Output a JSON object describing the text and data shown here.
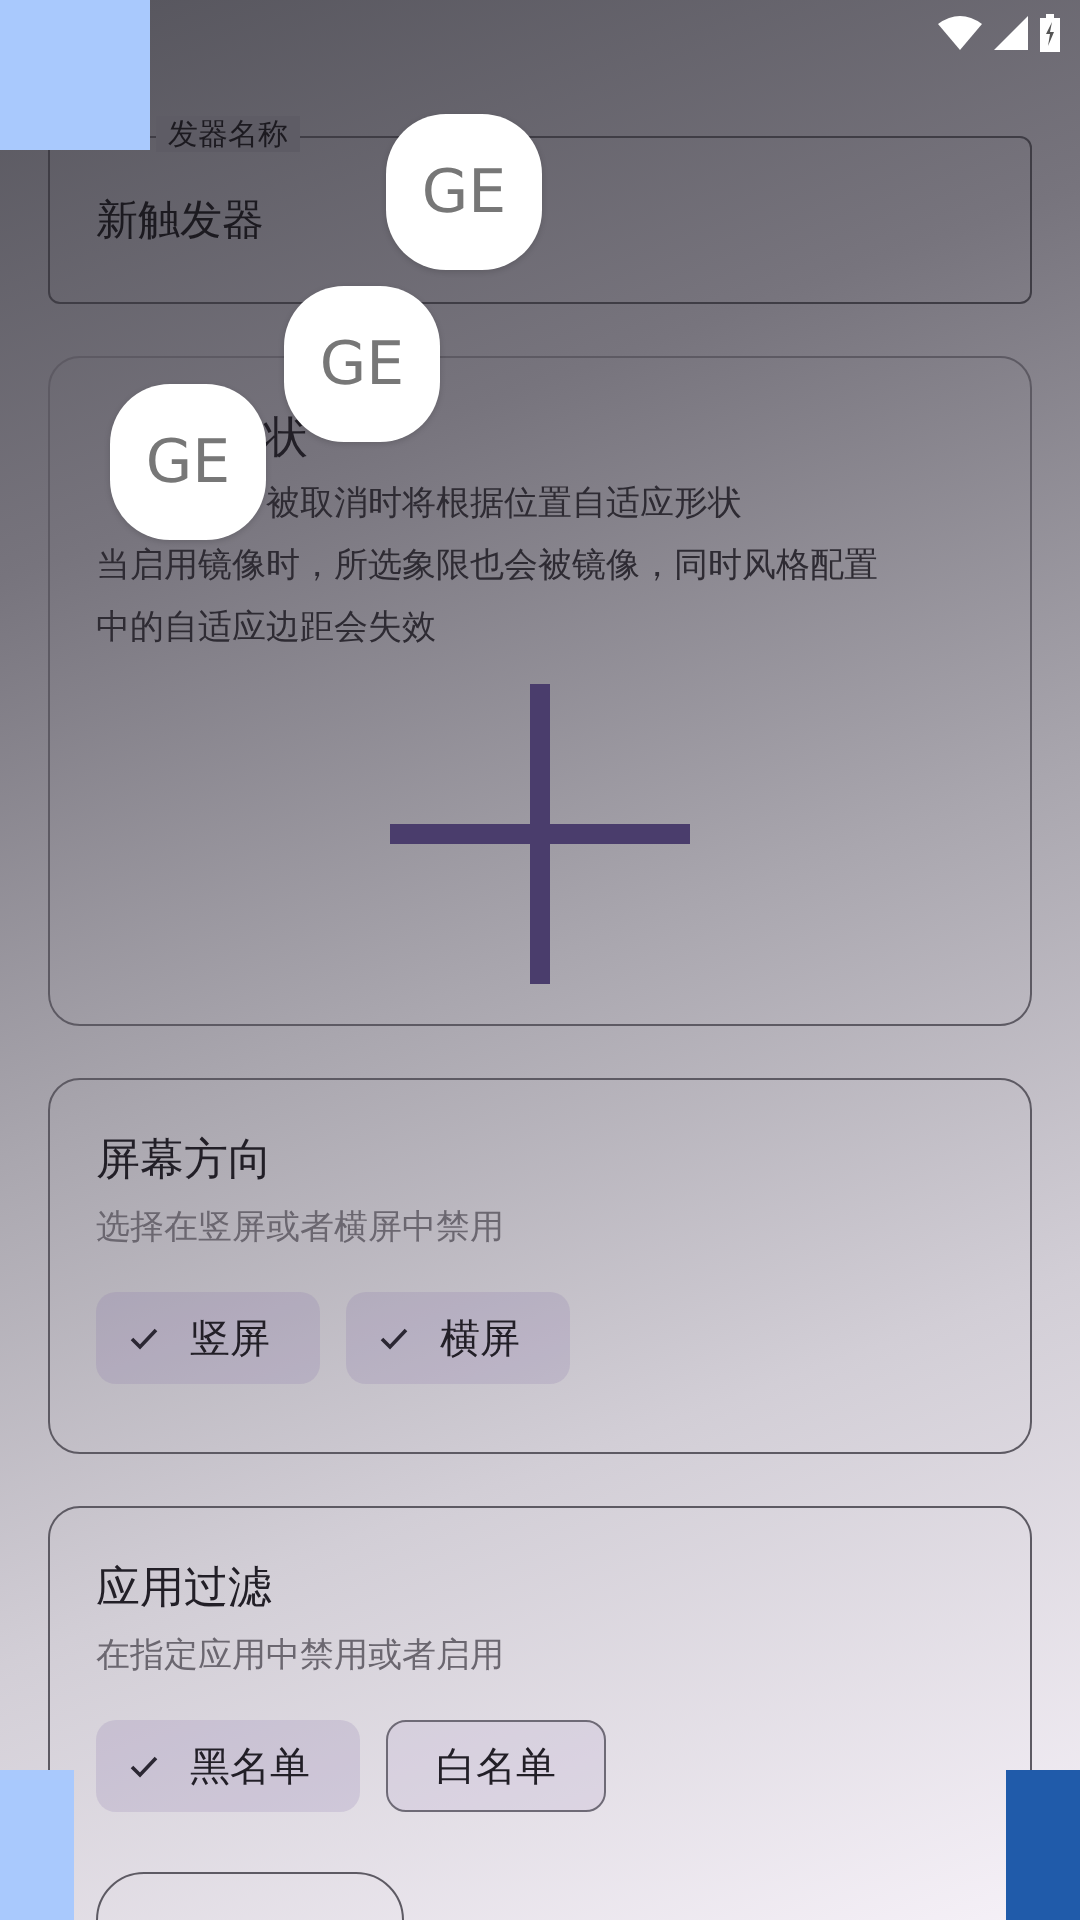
{
  "name_field": {
    "label": "发器名称",
    "value": "新触发器"
  },
  "shape_card": {
    "title": "状",
    "description": "被取消时将根据位置自适应形状",
    "description_lines": [
      "当启用镜像时，所选象限也会被镜像，同时风格配置",
      "中的自适应边距会失效"
    ]
  },
  "orientation_card": {
    "title": "屏幕方向",
    "description": "选择在竖屏或者横屏中禁用",
    "chips": [
      {
        "label": "竖屏",
        "selected": true
      },
      {
        "label": "横屏",
        "selected": true
      }
    ]
  },
  "filter_card": {
    "title": "应用过滤",
    "description": "在指定应用中禁用或者启用",
    "chips": [
      {
        "label": "黑名单",
        "selected": true
      },
      {
        "label": "白名单",
        "selected": false
      }
    ]
  },
  "floating_buttons": [
    {
      "label": "GE"
    },
    {
      "label": "GE"
    },
    {
      "label": "GE"
    }
  ]
}
